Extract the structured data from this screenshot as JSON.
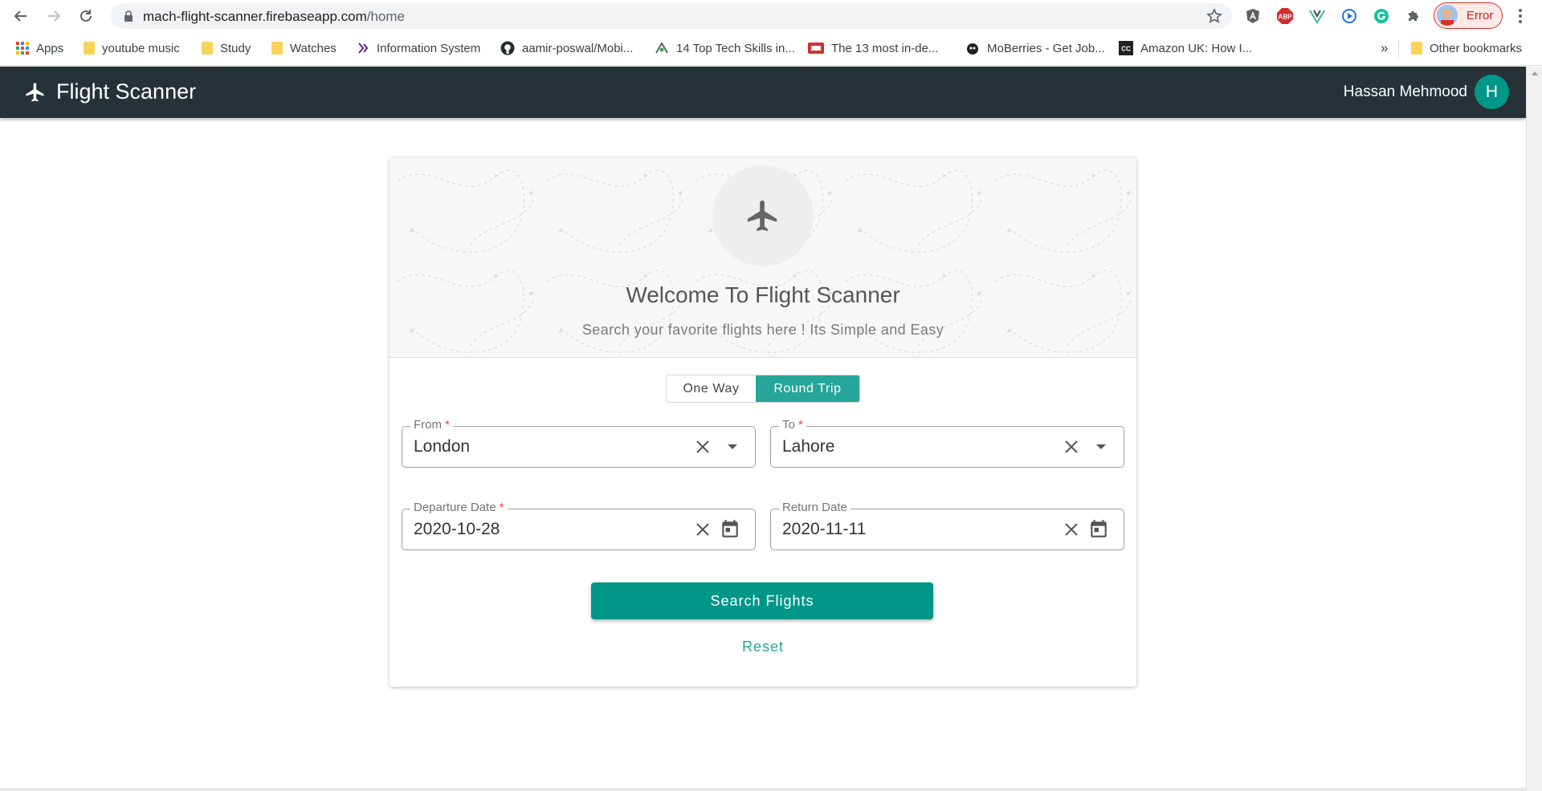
{
  "browser": {
    "url_host": "mach-flight-scanner.firebaseapp.com",
    "url_path": "/home",
    "profile_label": "Error",
    "bookmarks": [
      {
        "label": "Apps"
      },
      {
        "label": "youtube music"
      },
      {
        "label": "Study"
      },
      {
        "label": "Watches"
      },
      {
        "label": "Information System"
      },
      {
        "label": "aamir-poswal/Mobi..."
      },
      {
        "label": "14 Top Tech Skills in..."
      },
      {
        "label": "The 13 most in-de..."
      },
      {
        "label": "MoBerries - Get Job..."
      },
      {
        "label": "Amazon UK: How I..."
      }
    ],
    "overflow_label": "»",
    "other_bookmarks": "Other bookmarks"
  },
  "app": {
    "title": "Flight Scanner",
    "user_name": "Hassan Mehmood",
    "avatar_initial": "H",
    "brand_color": "#263238",
    "accent_color": "#009688"
  },
  "card": {
    "welcome": "Welcome To Flight Scanner",
    "subtitle": "Search your favorite flights here ! Its Simple and Easy",
    "trip_types": {
      "one_way": "One Way",
      "round_trip": "Round Trip",
      "selected": "Round Trip"
    },
    "from": {
      "label": "From",
      "required": "*",
      "value": "London"
    },
    "to": {
      "label": "To",
      "required": "*",
      "value": "Lahore"
    },
    "departure": {
      "label": "Departure Date",
      "required": "*",
      "value": "2020-10-28"
    },
    "return": {
      "label": "Return Date",
      "value": "2020-11-11"
    },
    "search_label": "Search Flights",
    "reset_label": "Reset"
  }
}
